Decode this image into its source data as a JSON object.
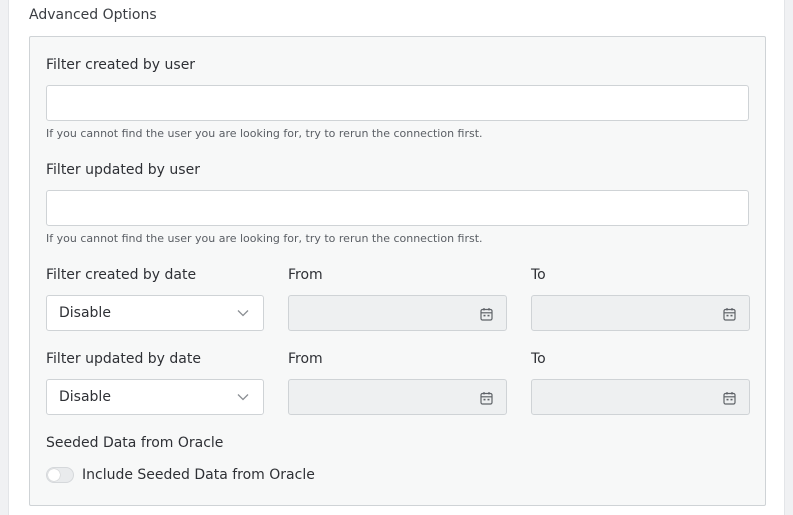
{
  "section": {
    "title": "Advanced Options"
  },
  "created_by_user": {
    "label": "Filter created by user",
    "value": "",
    "help": "If you cannot find the user you are looking for, try to rerun the connection first."
  },
  "updated_by_user": {
    "label": "Filter updated by user",
    "value": "",
    "help": "If you cannot find the user you are looking for, try to rerun the connection first."
  },
  "created_by_date": {
    "label": "Filter created by date",
    "select_value": "Disable",
    "from_label": "From",
    "to_label": "To",
    "from_value": "",
    "to_value": ""
  },
  "updated_by_date": {
    "label": "Filter updated by date",
    "select_value": "Disable",
    "from_label": "From",
    "to_label": "To",
    "from_value": "",
    "to_value": ""
  },
  "seeded": {
    "label": "Seeded Data from Oracle",
    "toggle_label": "Include Seeded Data from Oracle",
    "toggle_on": false
  },
  "icons": {
    "select": "chevron-down-icon",
    "date": "calendar-icon"
  },
  "colors": {
    "panel_bg": "#f7f8f8",
    "border": "#cfd3d6",
    "disabled_bg": "#eef0f1"
  }
}
